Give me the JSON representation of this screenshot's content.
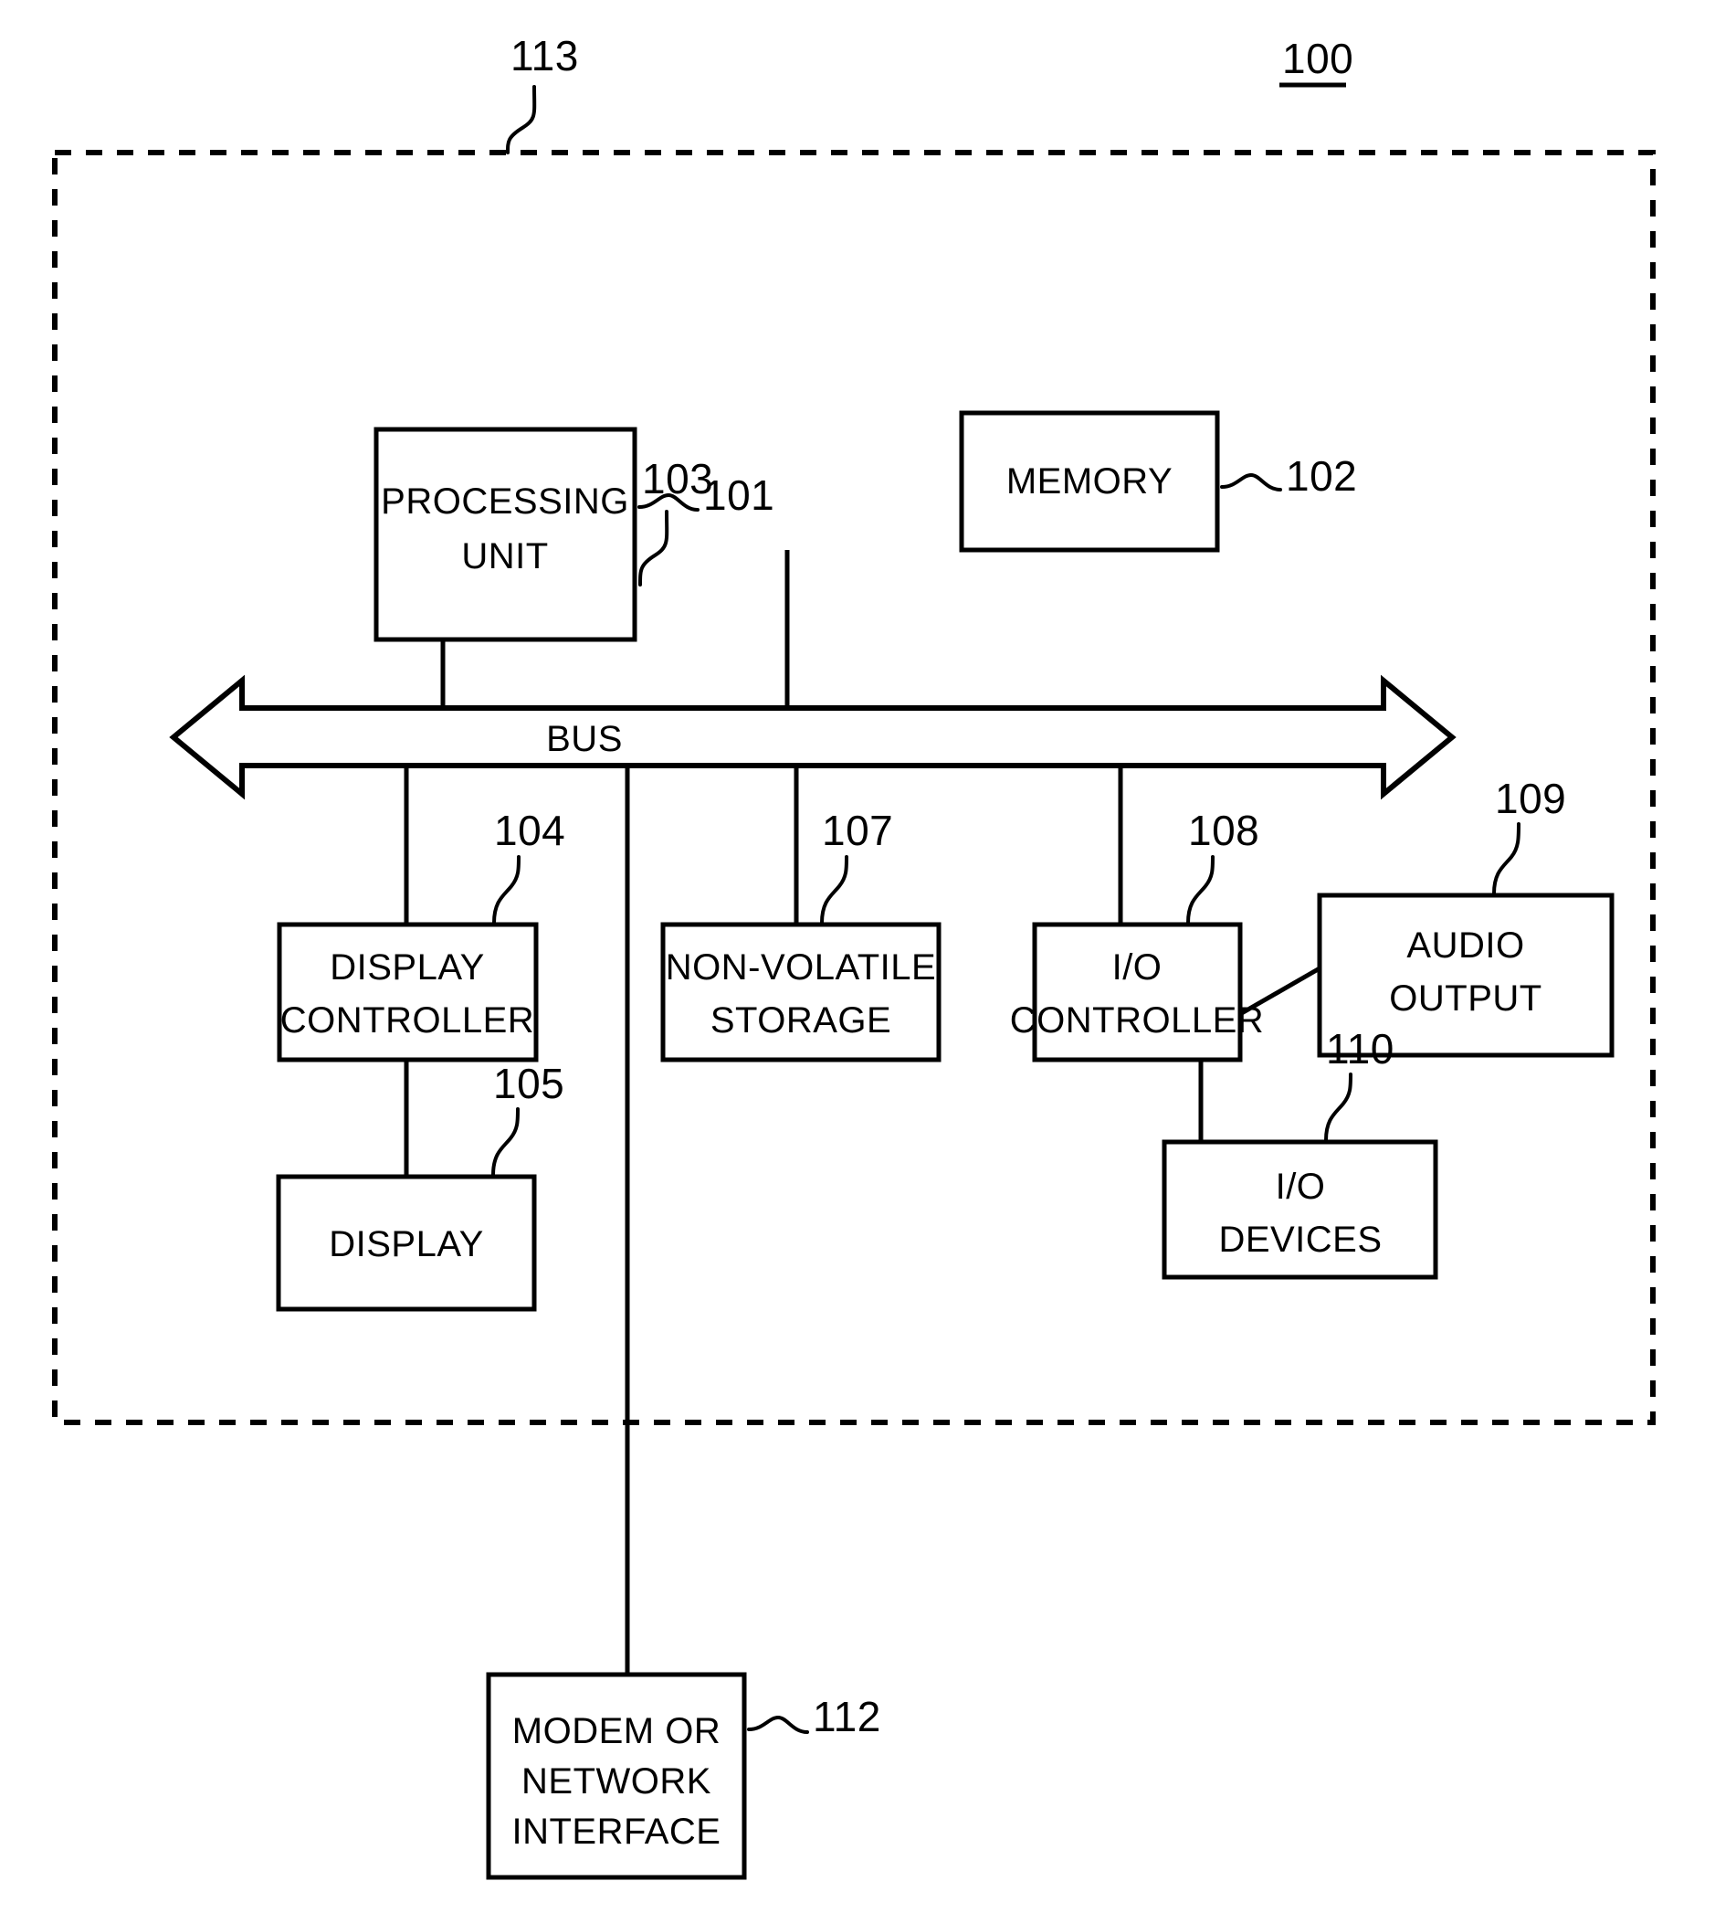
{
  "figure": {
    "title_ref": "100",
    "enclosure_ref": "113",
    "background_color": "#ffffff",
    "line_color": "#000000"
  },
  "bus": {
    "label": "BUS",
    "ref": "103"
  },
  "blocks": [
    {
      "id": "processing-unit",
      "lines": [
        "PROCESSING",
        "UNIT"
      ],
      "ref": "101"
    },
    {
      "id": "memory",
      "lines": [
        "MEMORY"
      ],
      "ref": "102"
    },
    {
      "id": "display-controller",
      "lines": [
        "DISPLAY",
        "CONTROLLER"
      ],
      "ref": "104"
    },
    {
      "id": "display",
      "lines": [
        "DISPLAY"
      ],
      "ref": "105"
    },
    {
      "id": "nonvolatile-storage",
      "lines": [
        "NON-VOLATILE",
        "STORAGE"
      ],
      "ref": "107"
    },
    {
      "id": "io-controller",
      "lines": [
        "I/O",
        "CONTROLLER"
      ],
      "ref": "108"
    },
    {
      "id": "audio-output",
      "lines": [
        "AUDIO",
        "OUTPUT"
      ],
      "ref": "109"
    },
    {
      "id": "io-devices",
      "lines": [
        "I/O",
        "DEVICES"
      ],
      "ref": "110"
    },
    {
      "id": "modem-network",
      "lines": [
        "MODEM OR",
        "NETWORK",
        "INTERFACE"
      ],
      "ref": "112"
    }
  ],
  "labels": {
    "processing_unit_line1": "PROCESSING",
    "processing_unit_line2": "UNIT",
    "processing_unit_ref": "101",
    "memory_line1": "MEMORY",
    "memory_ref": "102",
    "bus_text": "BUS",
    "bus_ref": "103",
    "display_controller_line1": "DISPLAY",
    "display_controller_line2": "CONTROLLER",
    "display_controller_ref": "104",
    "display_line1": "DISPLAY",
    "display_ref": "105",
    "storage_line1": "NON-VOLATILE",
    "storage_line2": "STORAGE",
    "storage_ref": "107",
    "io_controller_line1": "I/O",
    "io_controller_line2": "CONTROLLER",
    "io_controller_ref": "108",
    "audio_output_line1": "AUDIO",
    "audio_output_line2": "OUTPUT",
    "audio_output_ref": "109",
    "io_devices_line1": "I/O",
    "io_devices_line2": "DEVICES",
    "io_devices_ref": "110",
    "modem_line1": "MODEM OR",
    "modem_line2": "NETWORK",
    "modem_line3": "INTERFACE",
    "modem_ref": "112",
    "enclosure_ref": "113",
    "system_ref": "100"
  }
}
